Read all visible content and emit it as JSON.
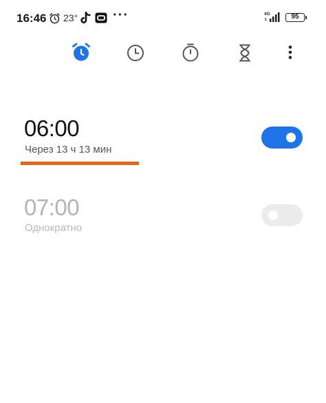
{
  "status_bar": {
    "time": "16:46",
    "temperature": "23°",
    "more": "···",
    "network": "4G",
    "battery": "95",
    "icons": [
      "alarm-clock-icon",
      "tiktok-icon",
      "app-icon",
      "signal-icon",
      "battery-icon"
    ]
  },
  "tabs": [
    {
      "name": "alarm",
      "icon": "alarm-clock-icon",
      "selected": true
    },
    {
      "name": "clock",
      "icon": "clock-icon",
      "selected": false
    },
    {
      "name": "stopwatch",
      "icon": "stopwatch-icon",
      "selected": false
    },
    {
      "name": "timer",
      "icon": "hourglass-icon",
      "selected": false
    }
  ],
  "menu_icon": "more-vertical-icon",
  "alarms": [
    {
      "time": "06:00",
      "subtitle": "Через 13 ч 13 мин",
      "enabled": true
    },
    {
      "time": "07:00",
      "subtitle": "Однократно",
      "enabled": false
    }
  ],
  "colors": {
    "accent": "#1e73e8",
    "highlight": "#e2661c",
    "inactive_text": "#b4b4b4",
    "tab_icon": "#555555"
  }
}
